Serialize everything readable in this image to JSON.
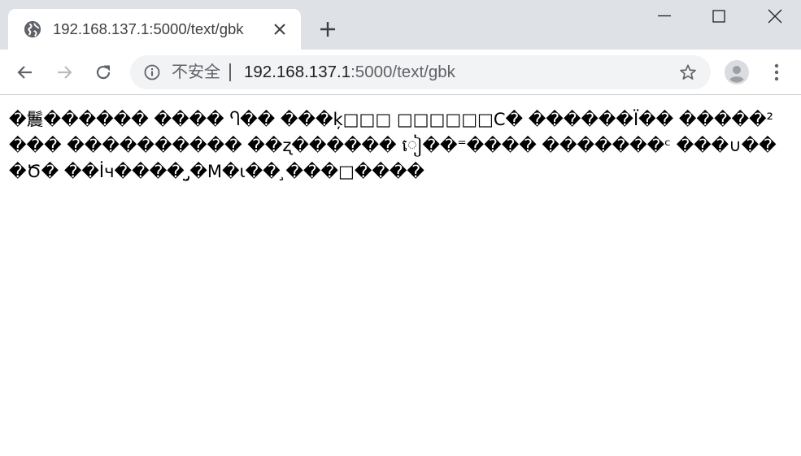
{
  "tab": {
    "title": "192.168.137.1:5000/text/gbk",
    "favicon": "globe-icon"
  },
  "window_controls": {
    "minimize": "minimize-icon",
    "maximize": "maximize-icon",
    "close": "close-icon"
  },
  "toolbar": {
    "back": "back-arrow-icon",
    "forward": "forward-arrow-icon",
    "reload": "reload-icon",
    "security_label": "不安全",
    "url_host": "192.168.137.1",
    "url_path": ":5000/text/gbk",
    "bookmark": "star-icon",
    "profile": "profile-avatar-icon",
    "menu": "more-vert-icon"
  },
  "page": {
    "body_text": "�鬞������ ���� Ⴄ�� ���ķ□□□ □□□□□□C� ������Ï�� �����²��� ���������� ��ʐ������ ៀ��⁼���� �������ᶜ ���∪���Ծ� ��İч���� ̡̤�Μ�ɩ�� ̧���□����"
  },
  "colors": {
    "tabstrip_bg": "#dee1e6",
    "omnibox_bg": "#f1f3f4",
    "icon_color": "#5f6368"
  }
}
